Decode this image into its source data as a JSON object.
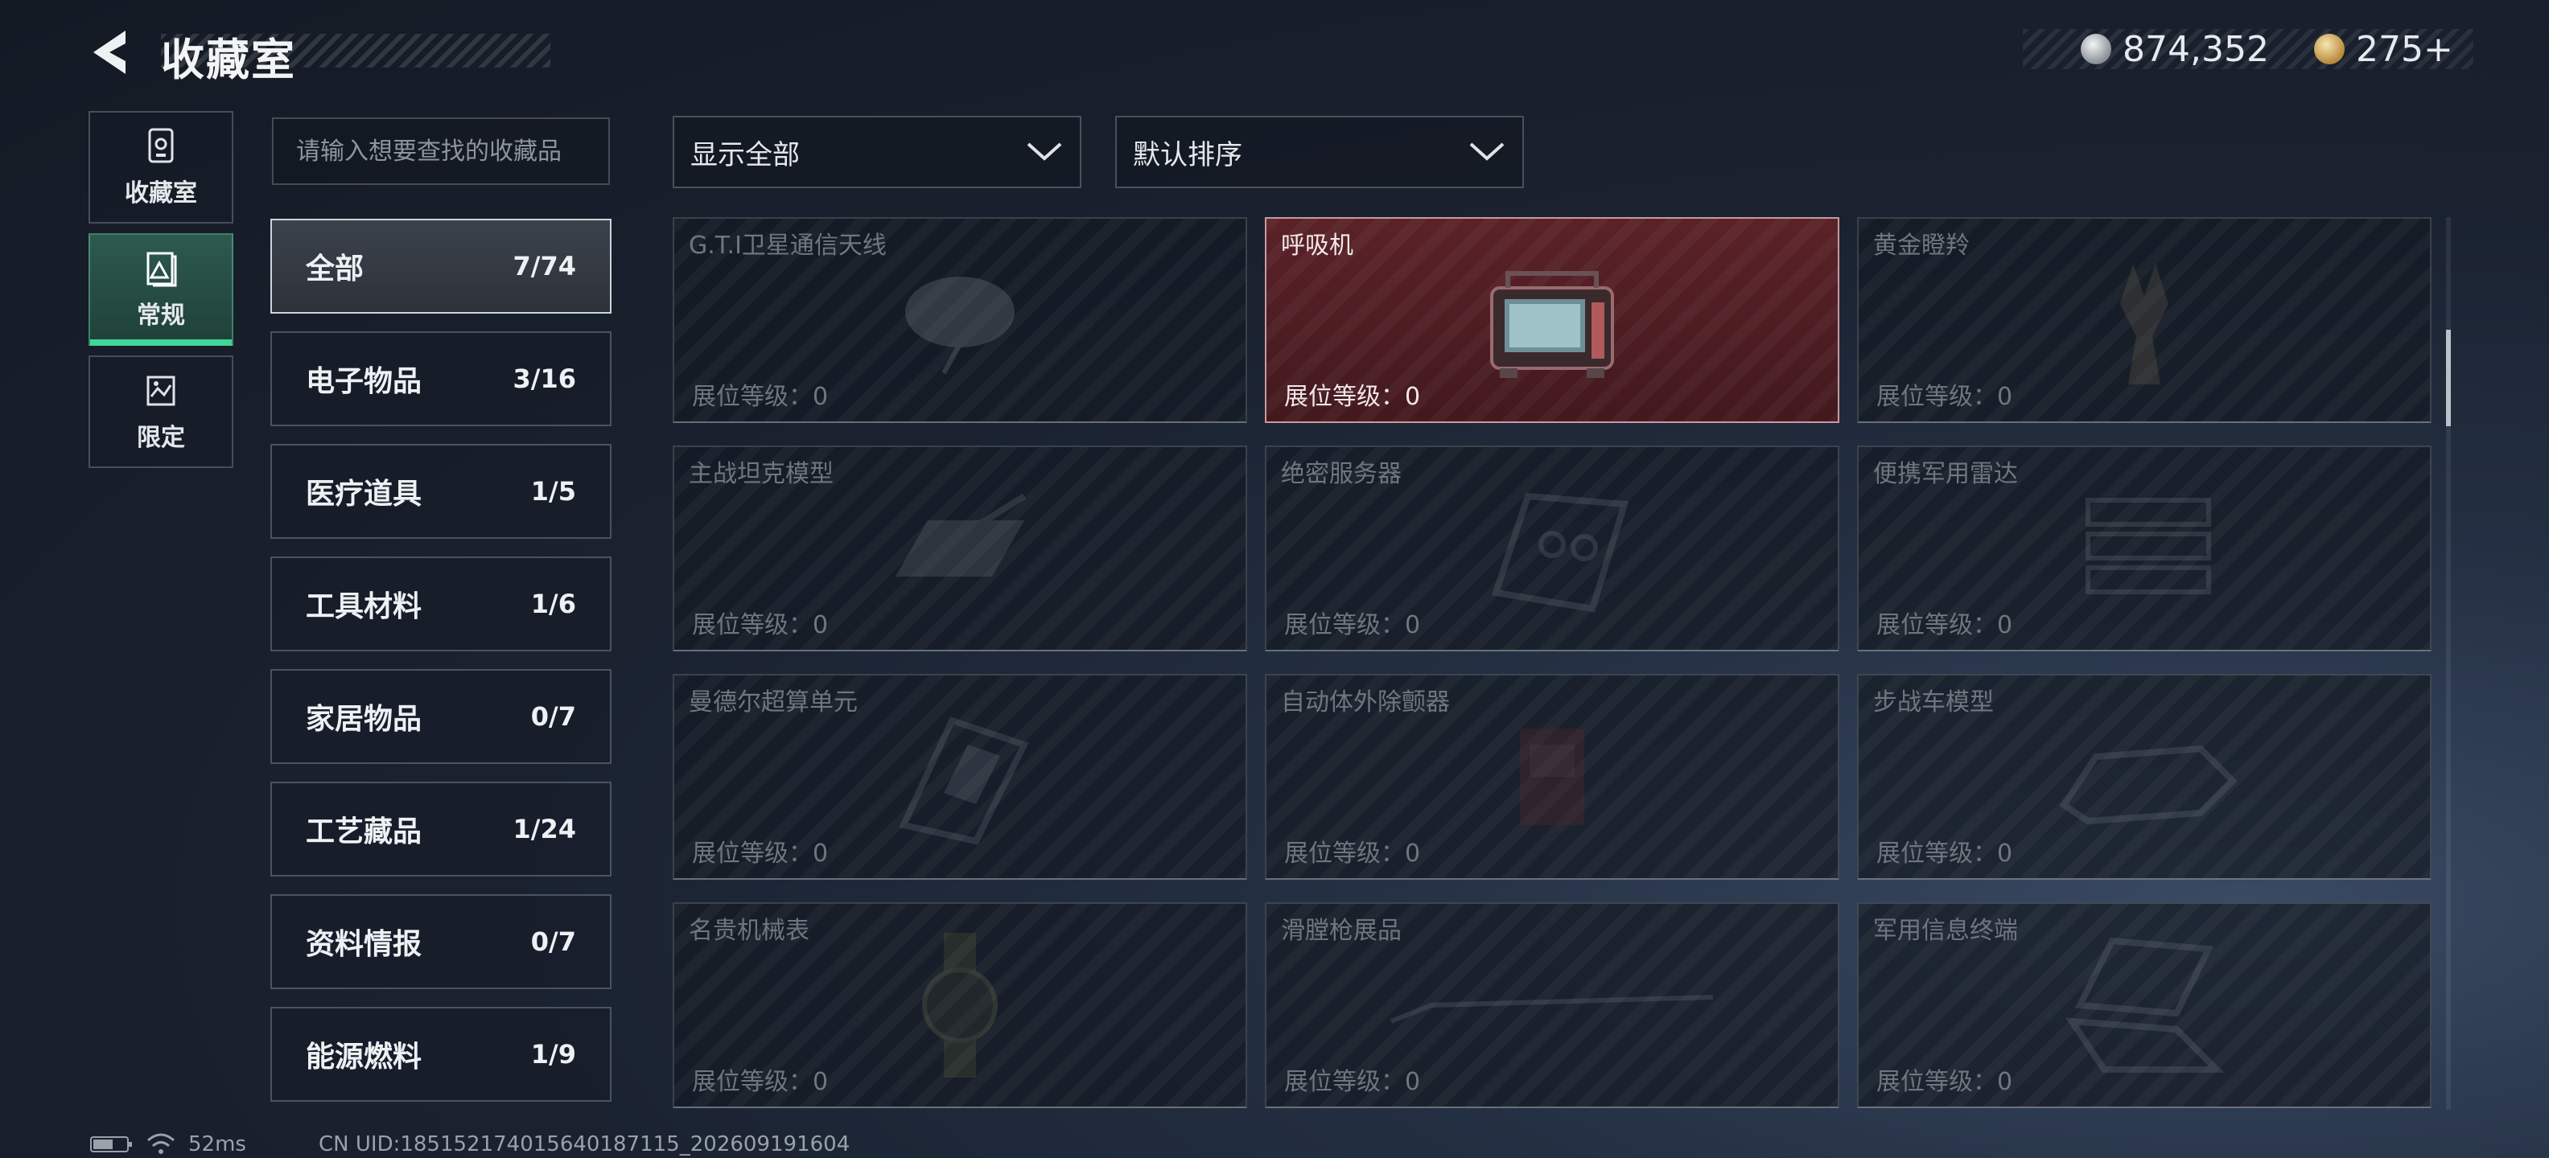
{
  "header": {
    "title": "收藏室",
    "currency": [
      {
        "icon": "silver-coin-icon",
        "value": "874,352"
      },
      {
        "icon": "gold-coin-icon",
        "value": "275+"
      }
    ]
  },
  "side_tabs": [
    {
      "label": "收藏室",
      "icon": "collection-room-icon",
      "active": false
    },
    {
      "label": "常规",
      "icon": "regular-collection-icon",
      "active": true
    },
    {
      "label": "限定",
      "icon": "limited-collection-icon",
      "active": false
    }
  ],
  "search": {
    "placeholder": "请输入想要查找的收藏品",
    "value": ""
  },
  "categories": [
    {
      "name": "全部",
      "count": "7/74",
      "active": true
    },
    {
      "name": "电子物品",
      "count": "3/16"
    },
    {
      "name": "医疗道具",
      "count": "1/5"
    },
    {
      "name": "工具材料",
      "count": "1/6"
    },
    {
      "name": "家居物品",
      "count": "0/7"
    },
    {
      "name": "工艺藏品",
      "count": "1/24"
    },
    {
      "name": "资料情报",
      "count": "0/7"
    },
    {
      "name": "能源燃料",
      "count": "1/9"
    }
  ],
  "filters": {
    "display": {
      "label": "显示全部"
    },
    "sort": {
      "label": "默认排序"
    }
  },
  "items": [
    {
      "name": "G.T.I卫星通信天线",
      "level": "展位等级：0",
      "owned": false
    },
    {
      "name": "呼吸机",
      "level": "展位等级：0",
      "owned": true
    },
    {
      "name": "黄金瞪羚",
      "level": "展位等级：0",
      "owned": false
    },
    {
      "name": "主战坦克模型",
      "level": "展位等级：0",
      "owned": false
    },
    {
      "name": "绝密服务器",
      "level": "展位等级：0",
      "owned": false
    },
    {
      "name": "便携军用雷达",
      "level": "展位等级：0",
      "owned": false
    },
    {
      "name": "曼德尔超算单元",
      "level": "展位等级：0",
      "owned": false
    },
    {
      "name": "自动体外除颤器",
      "level": "展位等级：0",
      "owned": false
    },
    {
      "name": "步战车模型",
      "level": "展位等级：0",
      "owned": false
    },
    {
      "name": "名贵机械表",
      "level": "展位等级：0",
      "owned": false
    },
    {
      "name": "滑膛枪展品",
      "level": "展位等级：0",
      "owned": false
    },
    {
      "name": "军用信息终端",
      "level": "展位等级：0",
      "owned": false
    }
  ],
  "status_bar": {
    "ping": "52ms",
    "uid": "CN UID:1851521740156401871​15_202609191604"
  },
  "colors": {
    "accent_green": "#3fd69a",
    "highlight_red": "#5a2228"
  }
}
